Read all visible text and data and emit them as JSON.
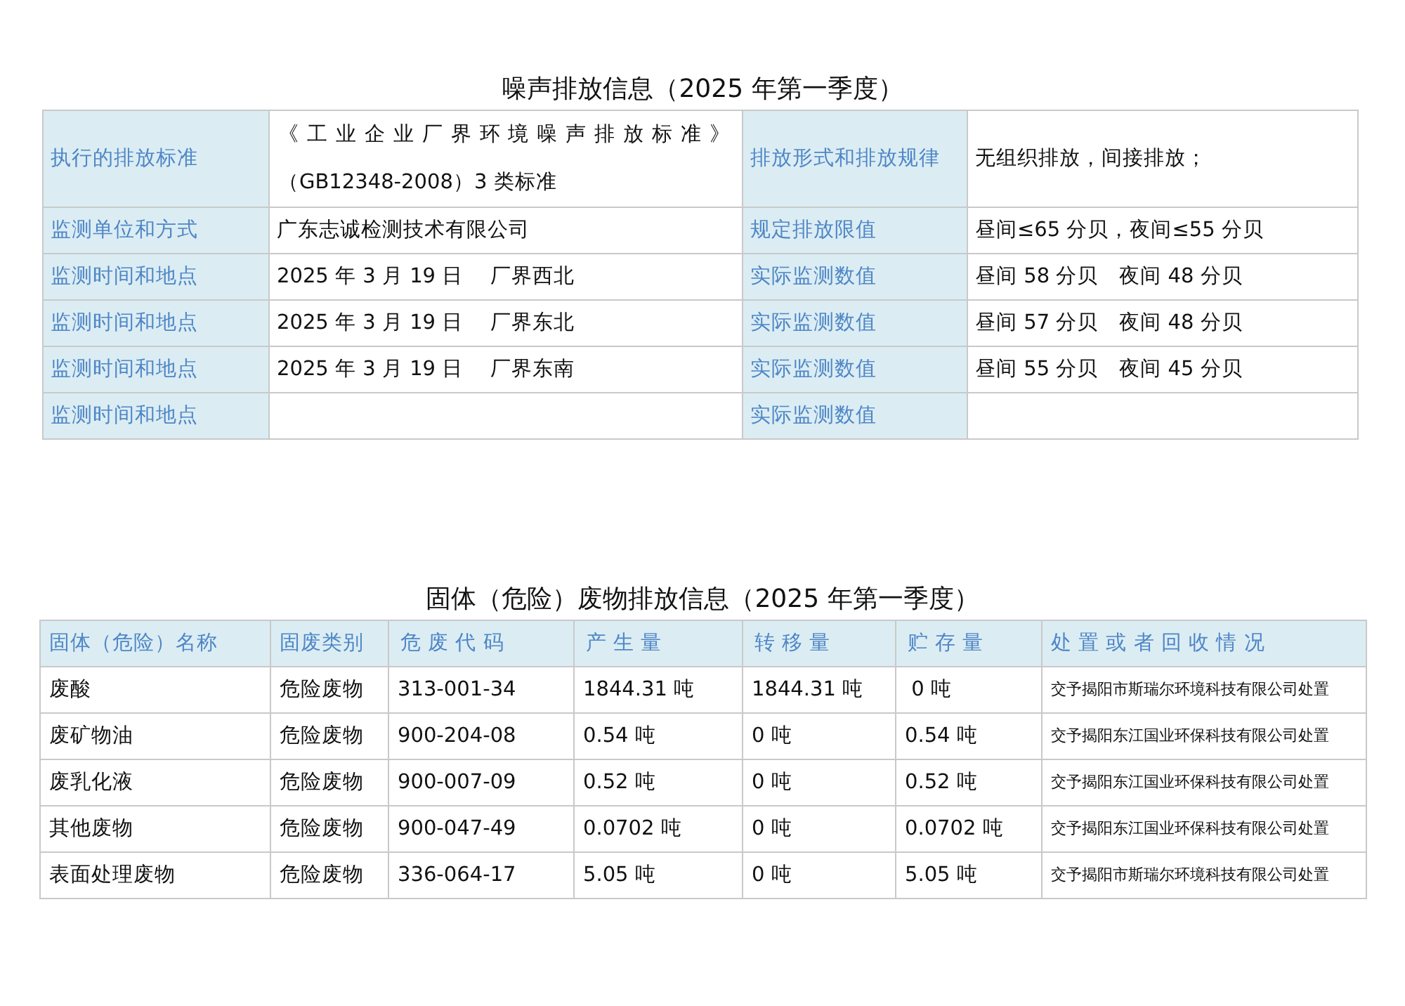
{
  "noise": {
    "title": "噪声排放信息（2025 年第一季度）",
    "rows": [
      {
        "label": "执行的排放标准",
        "value_lines": [
          "《工业企业厂界环境噪声排放标准》",
          "（GB12348-2008）3 类标准"
        ],
        "label_2": "排放形式和排放规律",
        "value_2": "无组织排放，间接排放；"
      },
      {
        "label": "监测单位和方式",
        "value": "广东志诚检测技术有限公司",
        "label_2": "规定排放限值",
        "value_2": "昼间≤65 分贝，夜间≤55 分贝"
      },
      {
        "label": "监测时间和地点",
        "value": "2025 年 3 月 19 日　 厂界西北",
        "label_2": "实际监测数值",
        "value_2": "昼间 58 分贝　夜间 48 分贝"
      },
      {
        "label": "监测时间和地点",
        "value": "2025 年 3 月 19 日　 厂界东北",
        "label_2": "实际监测数值",
        "value_2": "昼间 57 分贝　夜间 48 分贝"
      },
      {
        "label": "监测时间和地点",
        "value": "2025 年 3 月 19 日　 厂界东南",
        "label_2": "实际监测数值",
        "value_2": "昼间 55 分贝　夜间 45 分贝"
      },
      {
        "label": "监测时间和地点",
        "label_2": "实际监测数值"
      }
    ]
  },
  "waste": {
    "title": "固体（危险）废物排放信息（2025 年第一季度）",
    "columns": [
      "固体（危险）名称",
      "固废类别",
      "危 废 代 码",
      "产 生 量",
      "转 移 量",
      "贮 存 量",
      "处 置 或 者 回 收 情 况"
    ],
    "rows": [
      [
        "废酸",
        "危险废物",
        "313-001-34",
        "1844.31 吨",
        "1844.31 吨",
        " 0 吨",
        "交予揭阳市斯瑞尔环境科技有限公司处置"
      ],
      [
        "废矿物油",
        "危险废物",
        "900-204-08",
        "0.54 吨",
        "0 吨",
        "0.54 吨",
        "交予揭阳东江国业环保科技有限公司处置"
      ],
      [
        "废乳化液",
        "危险废物",
        "900-007-09",
        "0.52 吨",
        "0 吨",
        "0.52 吨",
        "交予揭阳东江国业环保科技有限公司处置"
      ],
      [
        "其他废物",
        "危险废物",
        "900-047-49",
        "0.0702 吨",
        "0 吨",
        "0.0702 吨",
        "交予揭阳东江国业环保科技有限公司处置"
      ],
      [
        "表面处理废物",
        "危险废物",
        "336-064-17",
        "5.05 吨",
        "0 吨",
        "5.05 吨",
        "交予揭阳市斯瑞尔环境科技有限公司处置"
      ]
    ]
  }
}
